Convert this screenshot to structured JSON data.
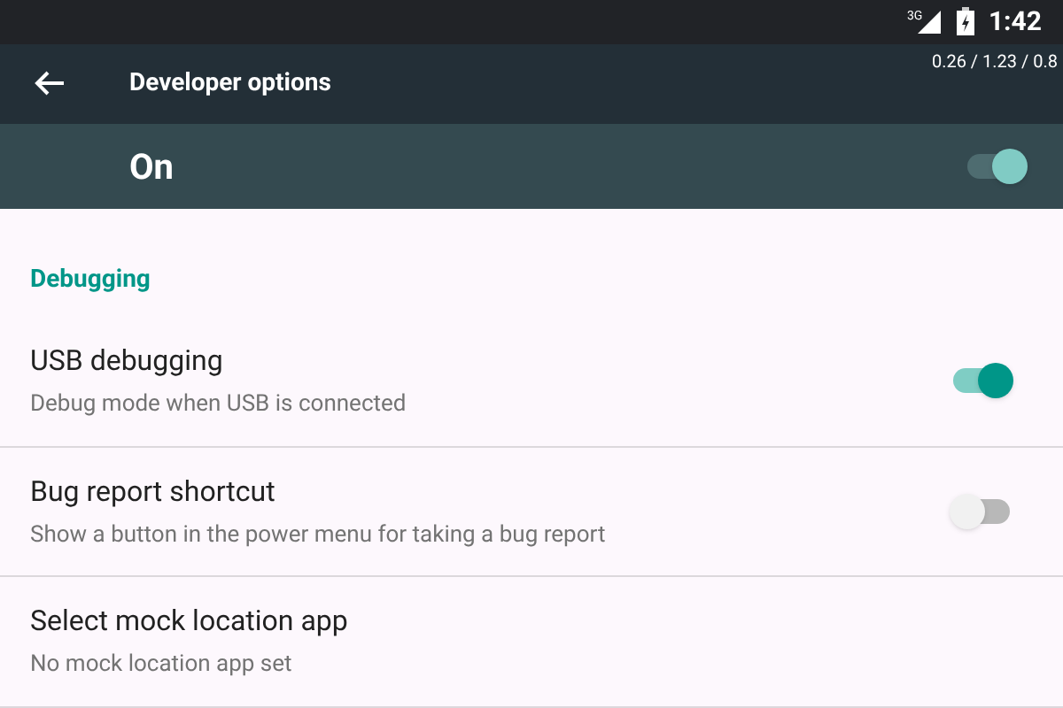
{
  "status_bar": {
    "network": "3G",
    "time": "1:42"
  },
  "toolbar": {
    "title": "Developer options",
    "overlay": "0.26 / 1.23 / 0.8"
  },
  "master_switch": {
    "label": "On",
    "on": true
  },
  "section": {
    "header": "Debugging",
    "items": [
      {
        "kind": "switch",
        "title": "USB debugging",
        "summary": "Debug mode when USB is connected",
        "on": true
      },
      {
        "kind": "switch",
        "title": "Bug report shortcut",
        "summary": "Show a button in the power menu for taking a bug report",
        "on": false
      },
      {
        "kind": "plain",
        "title": "Select mock location app",
        "summary": "No mock location app set"
      }
    ]
  }
}
